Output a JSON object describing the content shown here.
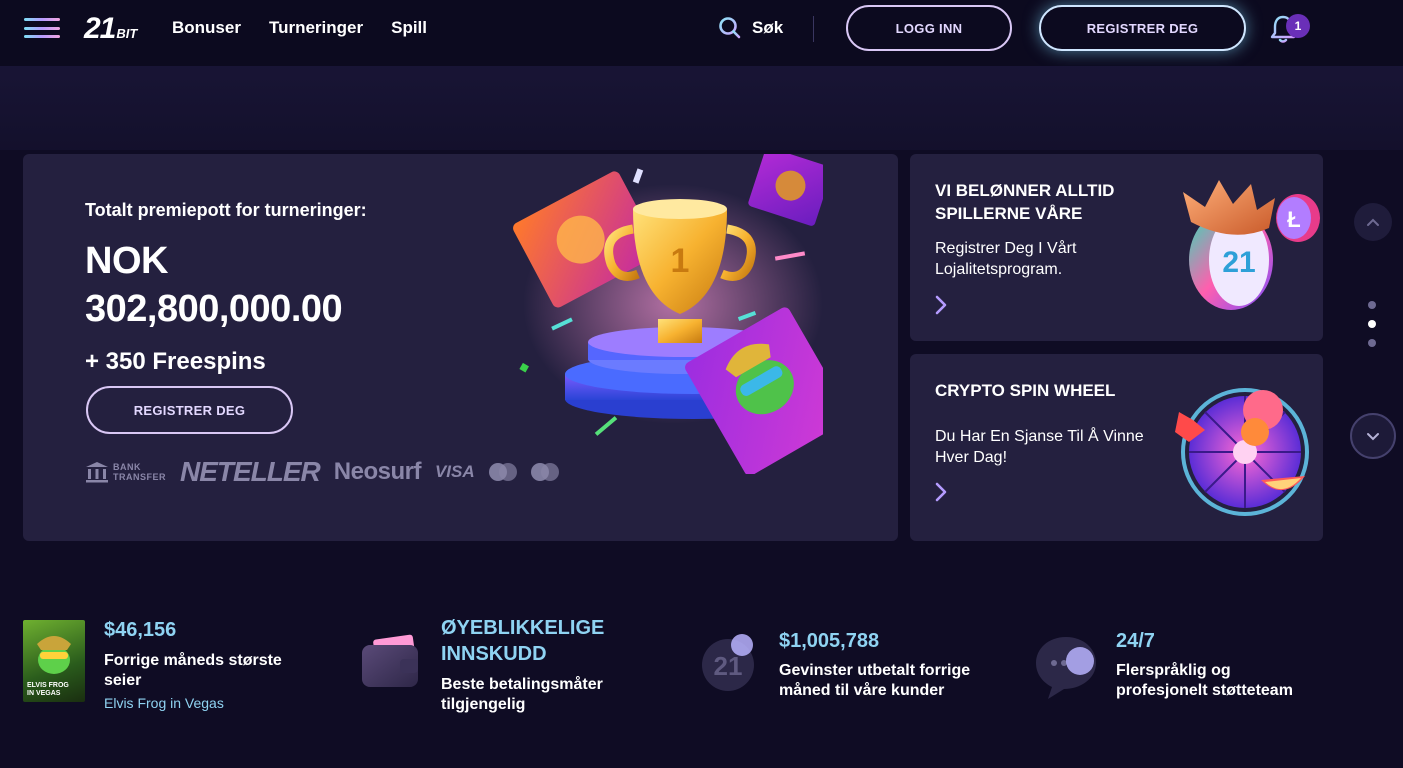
{
  "header": {
    "logo_big": "21",
    "logo_small": "BIT",
    "nav": [
      "Bonuser",
      "Turneringer",
      "Spill"
    ],
    "search_label": "Søk",
    "login_label": "LOGG INN",
    "register_label": "REGISTRER DEG",
    "notification_count": "1"
  },
  "hero": {
    "subtitle": "Totalt premiepott for turneringer:",
    "currency": "NOK",
    "amount": "302,800,000.00",
    "freespins": "+ 350 Freespins",
    "register_label": "REGISTRER DEG",
    "payments": {
      "bank": "BANK",
      "transfer": "TRANSFER",
      "neteller": "NETELLER",
      "neosurf": "Neosurf",
      "visa": "VISA"
    },
    "trophy_text": "1"
  },
  "cards": [
    {
      "title": "VI BELØNNER ALLTID SPILLERNE VÅRE",
      "desc": "Registrer Deg I Vårt Lojalitetsprogram.",
      "badge": "21"
    },
    {
      "title": "CRYPTO SPIN WHEEL",
      "desc": "Du Har En Sjanse Til Å Vinne Hver Dag!"
    }
  ],
  "slider": {
    "dot_count": 3,
    "active_dot": 1
  },
  "features": {
    "biggest_win": {
      "value": "$46,156",
      "desc": "Forrige måneds største seier",
      "game": "Elvis Frog in Vegas",
      "thumb_line1": "ELVIS FROG",
      "thumb_line2": "IN VEGAS"
    },
    "deposits": {
      "value": "ØYEBLIKKELIGE INNSKUDD",
      "desc": "Beste betalingsmåter tilgjengelig"
    },
    "payouts": {
      "value": "$1,005,788",
      "desc": "Gevinster utbetalt forrige måned til våre kunder",
      "icon_text": "21"
    },
    "support": {
      "value": "24/7",
      "desc": "Flerspråklig og profesjonelt støtteteam"
    }
  },
  "colors": {
    "background": "#0f0c24",
    "card": "#24203f",
    "accent_text": "#8fd3f2",
    "button_border": "#d9c7f5",
    "badge": "#6a2fb8"
  },
  "icons": [
    "menu-icon",
    "search-icon",
    "bell-icon",
    "chevron-right-icon",
    "chevron-up-icon",
    "chevron-down-icon",
    "wallet-icon",
    "coin-icon",
    "chat-icon",
    "bank-icon"
  ]
}
